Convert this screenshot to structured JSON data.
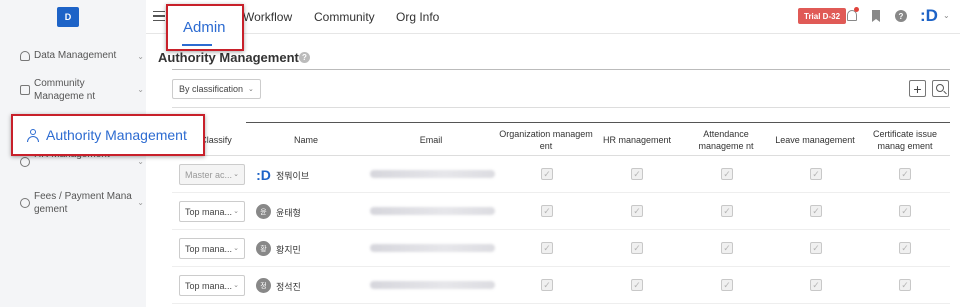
{
  "sidebar": {
    "logo_text": "D",
    "items": [
      {
        "label": "Data Management",
        "icon": "database-icon"
      },
      {
        "label": "Community Manageme nt",
        "icon": "community-icon"
      },
      {
        "label": "Authority Management",
        "icon": "user-icon",
        "selected": true
      },
      {
        "label": "HR Management",
        "icon": "hr-icon"
      },
      {
        "label": "Fees / Payment Mana gement",
        "icon": "fee-icon"
      }
    ]
  },
  "topnav": {
    "items": [
      "Admin",
      "Workflow",
      "Community",
      "Org Info"
    ],
    "active": "Admin",
    "trial_badge": "Trial D-32",
    "help_glyph": "?"
  },
  "page": {
    "title": "Authority Management",
    "help_glyph": "?",
    "classification_select": "By classification",
    "add_button": "+"
  },
  "table": {
    "headers": {
      "classify": "Classify",
      "name": "Name",
      "email": "Email",
      "org": "Organization managem ent",
      "hr": "HR management",
      "attendance": "Attendance manageme nt",
      "leave": "Leave management",
      "certificate": "Certificate issue manag ement"
    },
    "rows": [
      {
        "classify": "Master ac...",
        "disabled": true,
        "avatar": "D",
        "name": "정뭐이브"
      },
      {
        "classify": "Top mana...",
        "disabled": false,
        "avatar": "윤",
        "name": "윤태형"
      },
      {
        "classify": "Top mana...",
        "disabled": false,
        "avatar": "황",
        "name": "황지민"
      },
      {
        "classify": "Top mana...",
        "disabled": false,
        "avatar": "정",
        "name": "정석진"
      }
    ],
    "check_glyph": "✓"
  },
  "colors": {
    "accent": "#2c6bd1",
    "highlight_border": "#c8202a",
    "trial_badge": "#e05a56"
  }
}
